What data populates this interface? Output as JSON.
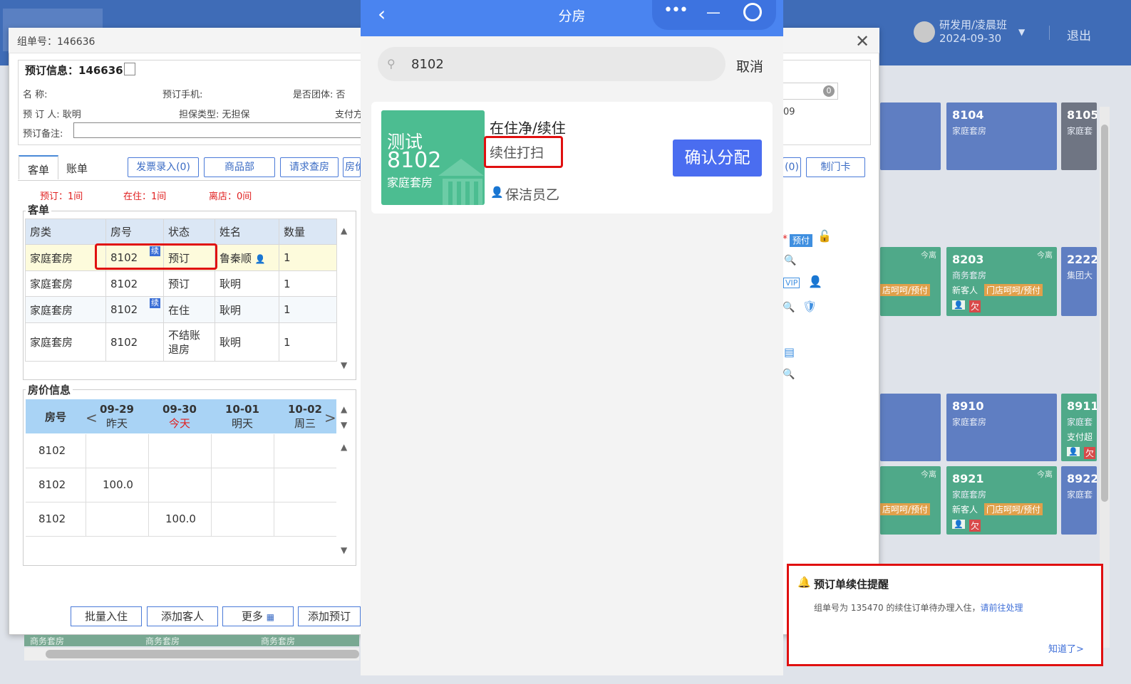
{
  "topbar": {
    "user_name": "研发用/凌晨班",
    "user_date": "2024-09-30",
    "logout": "退出"
  },
  "rooms": [
    {
      "number": "8104",
      "type": "家庭套房",
      "color": "blue"
    },
    {
      "number": "8105",
      "type": "家庭套",
      "color": "gray"
    },
    {
      "number": "8203",
      "type": "商务套房",
      "tag": "今离",
      "guest": "新客人",
      "source": "门店呵呵/预付",
      "owe": "欠",
      "color": "green"
    },
    {
      "number": "2222",
      "type": "集团大",
      "color": "blue"
    },
    {
      "number": "8910",
      "type": "家庭套房",
      "color": "blue"
    },
    {
      "number": "8911",
      "type": "家庭套",
      "extra": "支付超",
      "owe": "欠",
      "color": "green"
    },
    {
      "number": "8921",
      "type": "家庭套房",
      "tag": "今离",
      "guest": "新客人",
      "source": "门店呵呵/预付",
      "owe": "欠",
      "color": "green"
    },
    {
      "number": "8922",
      "type": "家庭套",
      "color": "blue"
    }
  ],
  "left_partial": {
    "tag": "今离",
    "source": "店呵呵/预付"
  },
  "dialog": {
    "title": "组单号：146636",
    "info_title": "预订信息：146636",
    "fields": {
      "name": "名      称:",
      "phone": "预订手机:",
      "group": "是否团体: 否",
      "booker": "预 订 人: 耿明",
      "guarantee": "担保类型: 无担保",
      "pay": "支付方",
      "remark": "预订备注:"
    },
    "right_date": "09",
    "search_badge": "0",
    "tabs": [
      "客单",
      "账单"
    ],
    "buttons": [
      "发票录入(0)",
      "商品部",
      "请求查房",
      "房价"
    ],
    "right_buttons": [
      "(0)",
      "制门卡"
    ],
    "counts": {
      "reserve": "预订：1间",
      "stay": "在住：1间",
      "leave": "离店：0间"
    },
    "guest_section": "客单",
    "guest_headers": [
      "房类",
      "房号",
      "状态",
      "姓名",
      "数量"
    ],
    "guest_rows": [
      {
        "type": "家庭套房",
        "room": "8102",
        "status": "预订",
        "name": "鲁秦顺",
        "qty": "1",
        "xu": "续"
      },
      {
        "type": "家庭套房",
        "room": "8102",
        "status": "预订",
        "name": "耿明",
        "qty": "1"
      },
      {
        "type": "家庭套房",
        "room": "8102",
        "status": "在住",
        "name": "耿明",
        "qty": "1",
        "xu": "续"
      },
      {
        "type": "家庭套房",
        "room": "8102",
        "status": "不结账退房",
        "name": "耿明",
        "qty": "1"
      }
    ],
    "price_section": "房价信息",
    "price_headers": {
      "room": "房号",
      "dates": [
        {
          "date": "09-29",
          "label": "昨天"
        },
        {
          "date": "09-30",
          "label": "今天"
        },
        {
          "date": "10-01",
          "label": "明天"
        },
        {
          "date": "10-02",
          "label": "周三"
        }
      ]
    },
    "price_rows": [
      {
        "room": "8102",
        "values": [
          "",
          "",
          "",
          ""
        ]
      },
      {
        "room": "8102",
        "values": [
          "100.0",
          "",
          "",
          ""
        ]
      },
      {
        "room": "8102",
        "values": [
          "",
          "100.0",
          "",
          ""
        ]
      }
    ],
    "bottom_buttons": [
      "批量入住",
      "添加客人",
      "更多",
      "添加预订"
    ],
    "strip": [
      "商务套房",
      "商务套房",
      "商务套房"
    ],
    "prepay": "预付",
    "vip": "VIP"
  },
  "phone": {
    "title": "分房",
    "search_value": "8102",
    "cancel": "取消",
    "card": {
      "thumb_line1": "测试",
      "thumb_line2": "8102",
      "thumb_line3": "家庭套房",
      "status1": "在住净/续住",
      "status2": "续住打扫",
      "cleaner": "保洁员乙",
      "confirm": "确认分配"
    }
  },
  "notification": {
    "title": "预订单续住提醒",
    "message": "组单号为 135470 的续住订单待办理入住，",
    "link": "请前往处理",
    "ok": "知道了>"
  }
}
